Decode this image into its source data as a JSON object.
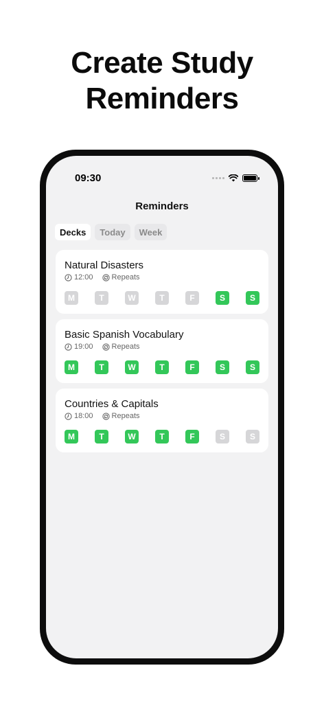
{
  "headline": {
    "line1": "Create Study",
    "line2": "Reminders"
  },
  "status_bar": {
    "time": "09:30"
  },
  "nav": {
    "title": "Reminders"
  },
  "tabs": [
    {
      "label": "Decks",
      "active": true
    },
    {
      "label": "Today",
      "active": false
    },
    {
      "label": "Week",
      "active": false
    }
  ],
  "reminders": [
    {
      "title": "Natural Disasters",
      "time": "12:00",
      "repeat_label": "Repeats",
      "days": [
        {
          "label": "M",
          "on": false
        },
        {
          "label": "T",
          "on": false
        },
        {
          "label": "W",
          "on": false
        },
        {
          "label": "T",
          "on": false
        },
        {
          "label": "F",
          "on": false
        },
        {
          "label": "S",
          "on": true
        },
        {
          "label": "S",
          "on": true
        }
      ]
    },
    {
      "title": "Basic Spanish Vocabulary",
      "time": "19:00",
      "repeat_label": "Repeats",
      "days": [
        {
          "label": "M",
          "on": true
        },
        {
          "label": "T",
          "on": true
        },
        {
          "label": "W",
          "on": true
        },
        {
          "label": "T",
          "on": true
        },
        {
          "label": "F",
          "on": true
        },
        {
          "label": "S",
          "on": true
        },
        {
          "label": "S",
          "on": true
        }
      ]
    },
    {
      "title": "Countries & Capitals",
      "time": "18:00",
      "repeat_label": "Repeats",
      "days": [
        {
          "label": "M",
          "on": true
        },
        {
          "label": "T",
          "on": true
        },
        {
          "label": "W",
          "on": true
        },
        {
          "label": "T",
          "on": true
        },
        {
          "label": "F",
          "on": true
        },
        {
          "label": "S",
          "on": false
        },
        {
          "label": "S",
          "on": false
        }
      ]
    }
  ],
  "icons": {
    "time": "clock-icon",
    "repeat": "repeat-icon",
    "wifi": "wifi-icon",
    "battery": "battery-icon",
    "signal": "cellular-signal-icon"
  },
  "colors": {
    "active_day": "#33c759",
    "inactive_day": "#d6d6d8",
    "screen_bg": "#f2f2f3",
    "frame": "#0d0d0d"
  }
}
